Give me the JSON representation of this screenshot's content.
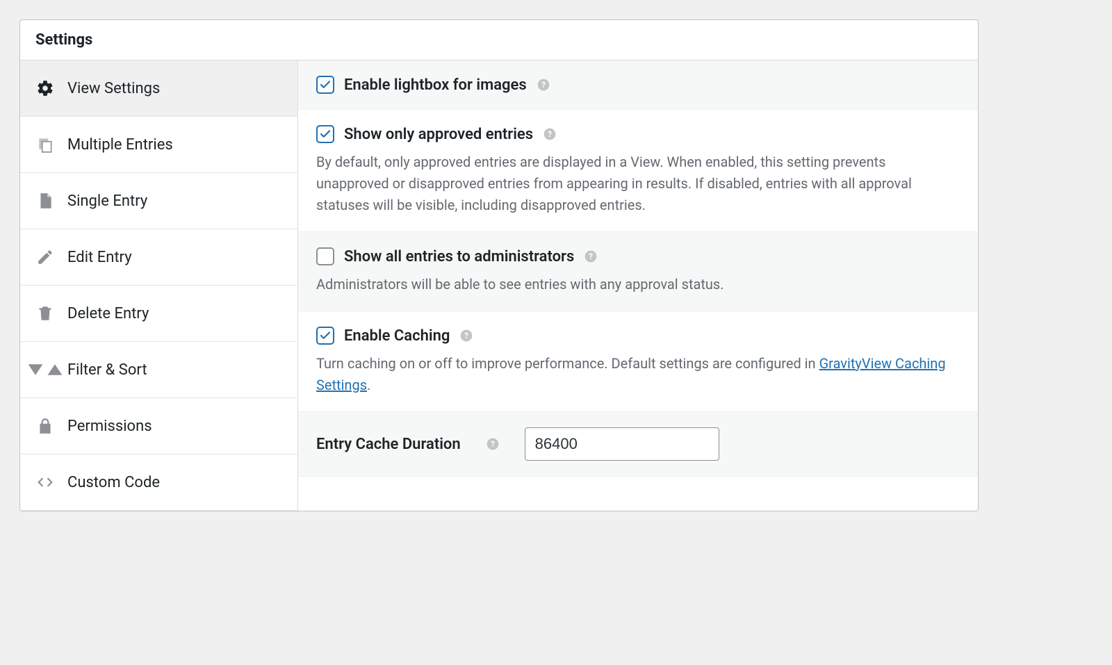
{
  "panel": {
    "title": "Settings"
  },
  "sidebar": {
    "items": [
      {
        "label": "View Settings"
      },
      {
        "label": "Multiple Entries"
      },
      {
        "label": "Single Entry"
      },
      {
        "label": "Edit Entry"
      },
      {
        "label": "Delete Entry"
      },
      {
        "label": "Filter & Sort"
      },
      {
        "label": "Permissions"
      },
      {
        "label": "Custom Code"
      }
    ]
  },
  "settings": {
    "lightbox": {
      "label": "Enable lightbox for images",
      "checked": true
    },
    "approved": {
      "label": "Show only approved entries",
      "checked": true,
      "desc": "By default, only approved entries are displayed in a View. When enabled, this setting prevents unapproved or disapproved entries from appearing in results. If disabled, entries with all approval statuses will be visible, including disapproved entries."
    },
    "admin_all": {
      "label": "Show all entries to administrators",
      "checked": false,
      "desc": "Administrators will be able to see entries with any approval status."
    },
    "caching": {
      "label": "Enable Caching",
      "checked": true,
      "desc_pre": "Turn caching on or off to improve performance. Default settings are configured in ",
      "link_text": "GravityView Caching Settings",
      "desc_post": "."
    },
    "cache_duration": {
      "label": "Entry Cache Duration",
      "value": "86400"
    }
  }
}
